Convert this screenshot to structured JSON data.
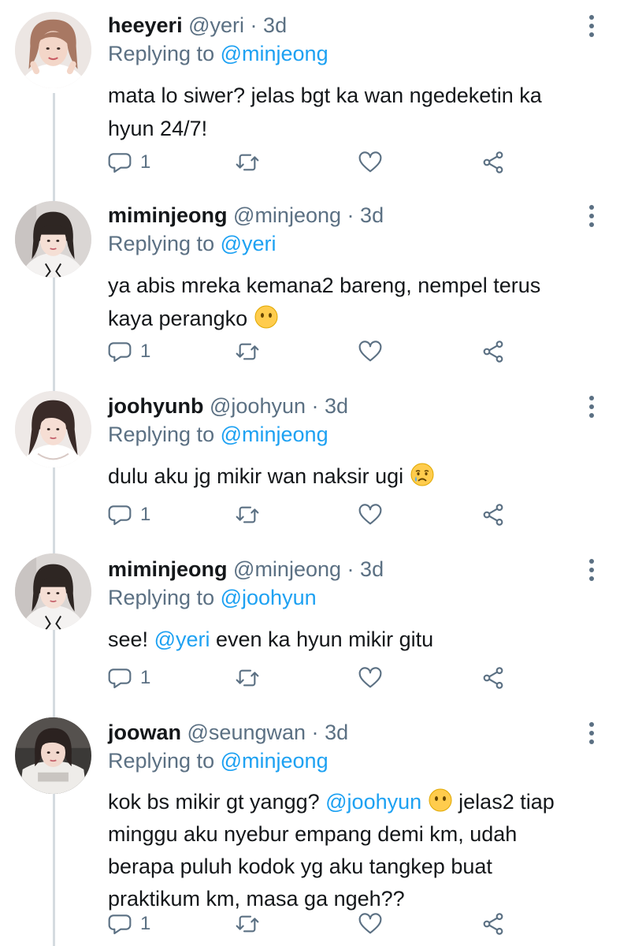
{
  "tweets": [
    {
      "display_name": "heeyeri",
      "handle": "@yeri",
      "time": "3d",
      "replying_label": "Replying to",
      "replying_to": "@minjeong",
      "text": "mata lo siwer? jelas bgt ka wan ngedeketin ka hyun 24/7!",
      "reply_count": "1"
    },
    {
      "display_name": "miminjeong",
      "handle": "@minjeong",
      "time": "3d",
      "replying_label": "Replying to",
      "replying_to": "@yeri",
      "text": "ya abis mreka kemana2 bareng, nempel terus kaya perangko",
      "emoji": "neutral-face-emoji",
      "reply_count": "1"
    },
    {
      "display_name": "joohyunb",
      "handle": "@joohyun",
      "time": "3d",
      "replying_label": "Replying to",
      "replying_to": "@minjeong",
      "text": "dulu aku jg mikir wan naksir ugi",
      "emoji": "crying-face-emoji",
      "reply_count": "1"
    },
    {
      "display_name": "miminjeong",
      "handle": "@minjeong",
      "time": "3d",
      "replying_label": "Replying to",
      "replying_to": "@joohyun",
      "text_pre": "see!",
      "text_mention": "@yeri",
      "text_post": "even ka hyun mikir gitu",
      "reply_count": "1"
    },
    {
      "display_name": "joowan",
      "handle": "@seungwan",
      "time": "3d",
      "replying_label": "Replying to",
      "replying_to": "@minjeong",
      "text_pre": "kok bs mikir gt yangg?",
      "text_mention": "@joohyun",
      "text_post": "jelas2 tiap minggu aku nyebur empang demi km, udah berapa puluh kodok yg aku tangkep buat praktikum km, masa ga ngeh??",
      "emoji": "neutral-face-emoji",
      "reply_count": "1"
    }
  ],
  "header_separator": "·",
  "icons": {
    "reply": "reply-icon",
    "retweet": "retweet-icon",
    "like": "like-icon",
    "share": "share-icon",
    "more": "more-options-icon"
  },
  "colors": {
    "text_primary": "#14171a",
    "text_secondary": "#5b7083",
    "link": "#1da1f2",
    "thread_line": "#d5dbe0"
  }
}
